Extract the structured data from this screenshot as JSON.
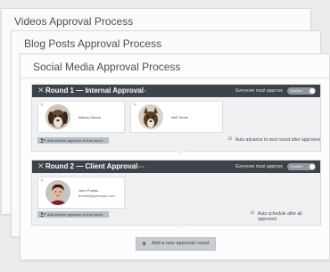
{
  "cards": {
    "videos_title": "Videos Approval Process",
    "blog_title": "Blog Posts Approval Process",
    "social_title": "Social Media Approval Process"
  },
  "rounds": [
    {
      "title": "Round 1 — Internal Approval",
      "change_name": "change name",
      "everyone_label": "Everyone must approve",
      "toggle_text": "Enabled",
      "approvers": [
        {
          "name": "Atticus Garcia",
          "email": ""
        },
        {
          "name": "Nell Torres",
          "email": ""
        }
      ],
      "add_approver_label": "Add another approver to this round",
      "auto_label": "Auto advance to next round after approved",
      "auto_checked": true
    },
    {
      "title": "Round 2 — Client Approval",
      "change_name": "change name",
      "everyone_label": "Everyone must approve",
      "toggle_text": "Enabled",
      "approvers": [
        {
          "name": "John Pueblo",
          "email": "brenda@gmmapp.com"
        }
      ],
      "add_approver_label": "Add another approver to this round",
      "auto_label": "Auto schedule after all approved",
      "auto_checked": true
    }
  ],
  "add_round_label": "Add a new approval round",
  "colors": {
    "header_bg": "#3d434a",
    "round_bg": "#eef0f2",
    "page_bg": "#ececee"
  },
  "icons": [
    "close-icon",
    "avatar",
    "add-person-icon",
    "checkbox-checked-icon",
    "plus-icon",
    "toggle-switch"
  ]
}
